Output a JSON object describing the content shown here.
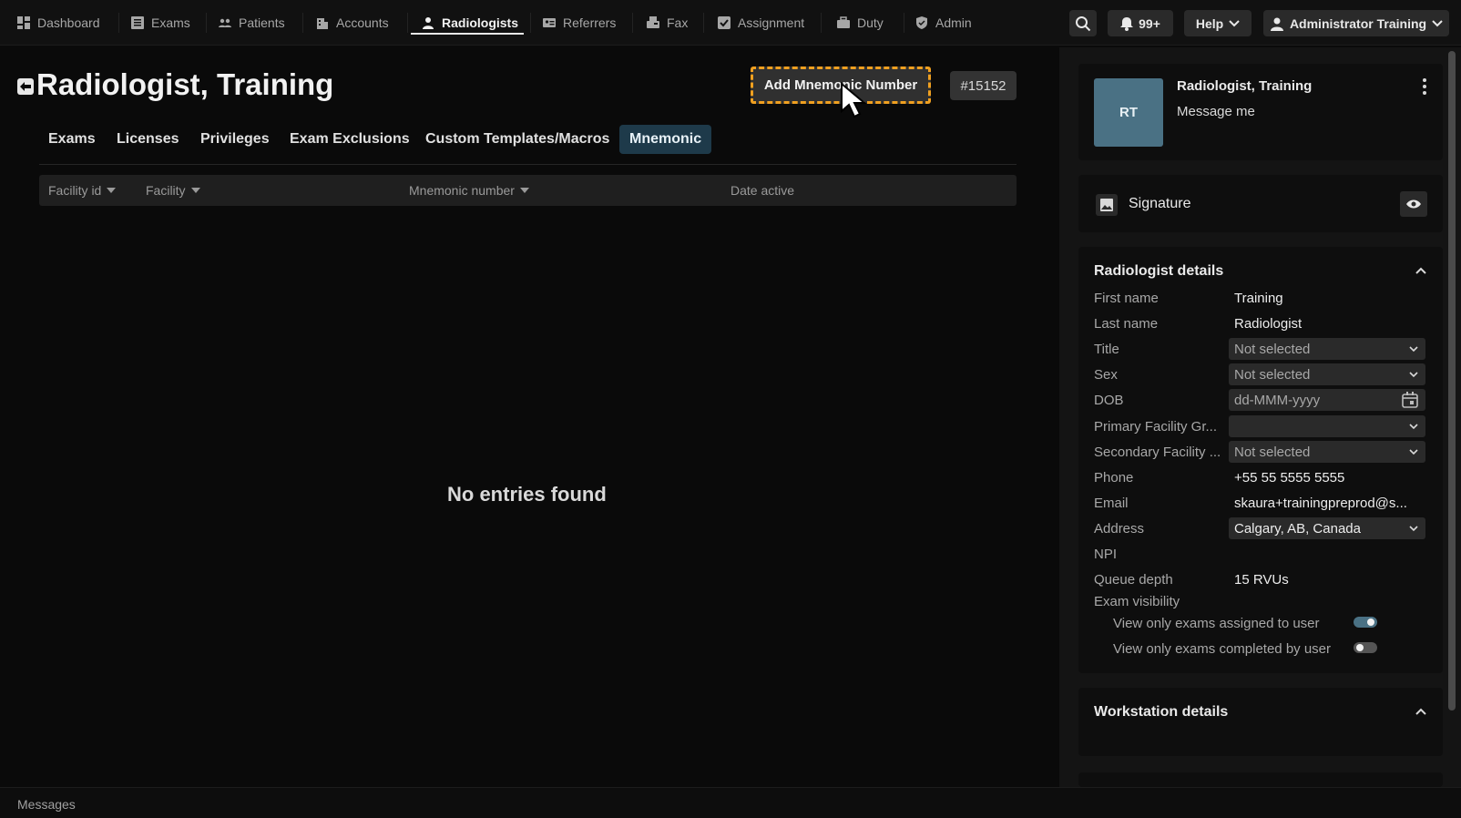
{
  "nav": {
    "items": [
      {
        "label": "Dashboard",
        "icon": "dashboard-icon"
      },
      {
        "label": "Exams",
        "icon": "exams-icon"
      },
      {
        "label": "Patients",
        "icon": "patients-icon"
      },
      {
        "label": "Accounts",
        "icon": "accounts-icon"
      },
      {
        "label": "Radiologists",
        "icon": "radiologist-icon"
      },
      {
        "label": "Referrers",
        "icon": "referrers-icon"
      },
      {
        "label": "Fax",
        "icon": "fax-icon"
      },
      {
        "label": "Assignment",
        "icon": "assignment-icon"
      },
      {
        "label": "Duty",
        "icon": "duty-icon"
      },
      {
        "label": "Admin",
        "icon": "admin-icon"
      }
    ],
    "active": "Radiologists",
    "notifications": "99+",
    "help": "Help",
    "user": "Administrator Training"
  },
  "page": {
    "title": "Radiologist, Training",
    "add_button": "Add Mnemonic Number",
    "id_badge": "#15152",
    "tabs": [
      "Exams",
      "Licenses",
      "Privileges",
      "Exam Exclusions",
      "Custom Templates/Macros",
      "Mnemonic"
    ],
    "active_tab": "Mnemonic",
    "columns": [
      "Facility id",
      "Facility",
      "Mnemonic number",
      "Date active"
    ],
    "empty_text": "No entries found"
  },
  "profile": {
    "initials": "RT",
    "name": "Radiologist, Training",
    "message": "Message me",
    "signature": "Signature"
  },
  "details": {
    "title": "Radiologist details",
    "first_name_label": "First name",
    "first_name": "Training",
    "last_name_label": "Last name",
    "last_name": "Radiologist",
    "title_label": "Title",
    "title_value": "Not selected",
    "sex_label": "Sex",
    "sex_value": "Not selected",
    "dob_label": "DOB",
    "dob_placeholder": "dd-MMM-yyyy",
    "primary_label": "Primary Facility Gr...",
    "primary_value": "",
    "secondary_label": "Secondary Facility ...",
    "secondary_value": "Not selected",
    "phone_label": "Phone",
    "phone": "+55 55 5555 5555",
    "email_label": "Email",
    "email": "skaura+trainingpreprod@s...",
    "address_label": "Address",
    "address": "Calgary, AB, Canada",
    "npi_label": "NPI",
    "queue_label": "Queue depth",
    "queue": "15 RVUs",
    "visibility_label": "Exam visibility",
    "toggle1_label": "View only exams assigned to user",
    "toggle1_on": true,
    "toggle2_label": "View only exams completed by user",
    "toggle2_on": false
  },
  "workstation": {
    "title": "Workstation details"
  },
  "footer": {
    "messages": "Messages"
  },
  "colors": {
    "accent_dashed": "#f0a020",
    "active_tab_bg": "#1e3a4a",
    "avatar_bg": "#4a7184",
    "toggle_on": "#4a7184"
  }
}
